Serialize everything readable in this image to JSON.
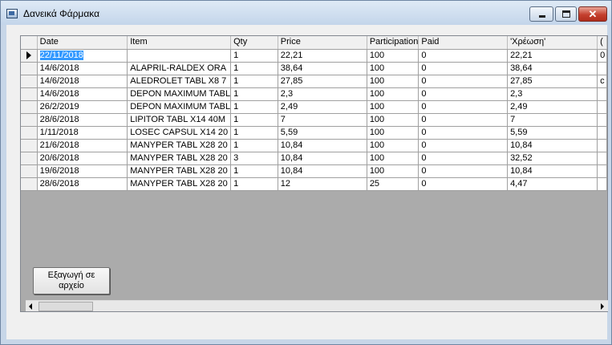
{
  "window": {
    "title": "Δανεικά Φάρμακα"
  },
  "table": {
    "columns": [
      "Date",
      "Item",
      "Qty",
      "Price",
      "Participation",
      "Paid",
      "'Χρέωση'",
      "("
    ],
    "rows": [
      [
        "22/11/2018",
        "",
        "1",
        "22,21",
        "100",
        "0",
        "22,21",
        "0"
      ],
      [
        "14/6/2018",
        "ALAPRIL-RALDEX ORA",
        "1",
        "38,64",
        "100",
        "0",
        "38,64",
        ""
      ],
      [
        "14/6/2018",
        "ALEDROLET TABL X8 7",
        "1",
        "27,85",
        "100",
        "0",
        "27,85",
        "c"
      ],
      [
        "14/6/2018",
        "DEPON MAXIMUM TABL",
        "1",
        "2,3",
        "100",
        "0",
        "2,3",
        ""
      ],
      [
        "26/2/2019",
        "DEPON MAXIMUM TABL",
        "1",
        "2,49",
        "100",
        "0",
        "2,49",
        ""
      ],
      [
        "28/6/2018",
        "LIPITOR TABL X14 40M",
        "1",
        "7",
        "100",
        "0",
        "7",
        ""
      ],
      [
        "1/11/2018",
        "LOSEC CAPSUL X14 20",
        "1",
        "5,59",
        "100",
        "0",
        "5,59",
        ""
      ],
      [
        "21/6/2018",
        "MANYPER TABL X28 20",
        "1",
        "10,84",
        "100",
        "0",
        "10,84",
        ""
      ],
      [
        "20/6/2018",
        "MANYPER TABL X28 20",
        "3",
        "10,84",
        "100",
        "0",
        "32,52",
        ""
      ],
      [
        "19/6/2018",
        "MANYPER TABL X28 20",
        "1",
        "10,84",
        "100",
        "0",
        "10,84",
        ""
      ],
      [
        "28/6/2018",
        "MANYPER TABL X28 20",
        "1",
        "12",
        "25",
        "0",
        "4,47",
        ""
      ]
    ]
  },
  "export_button": {
    "line1": "Εξαγωγή σε",
    "line2": "αρχείο"
  }
}
